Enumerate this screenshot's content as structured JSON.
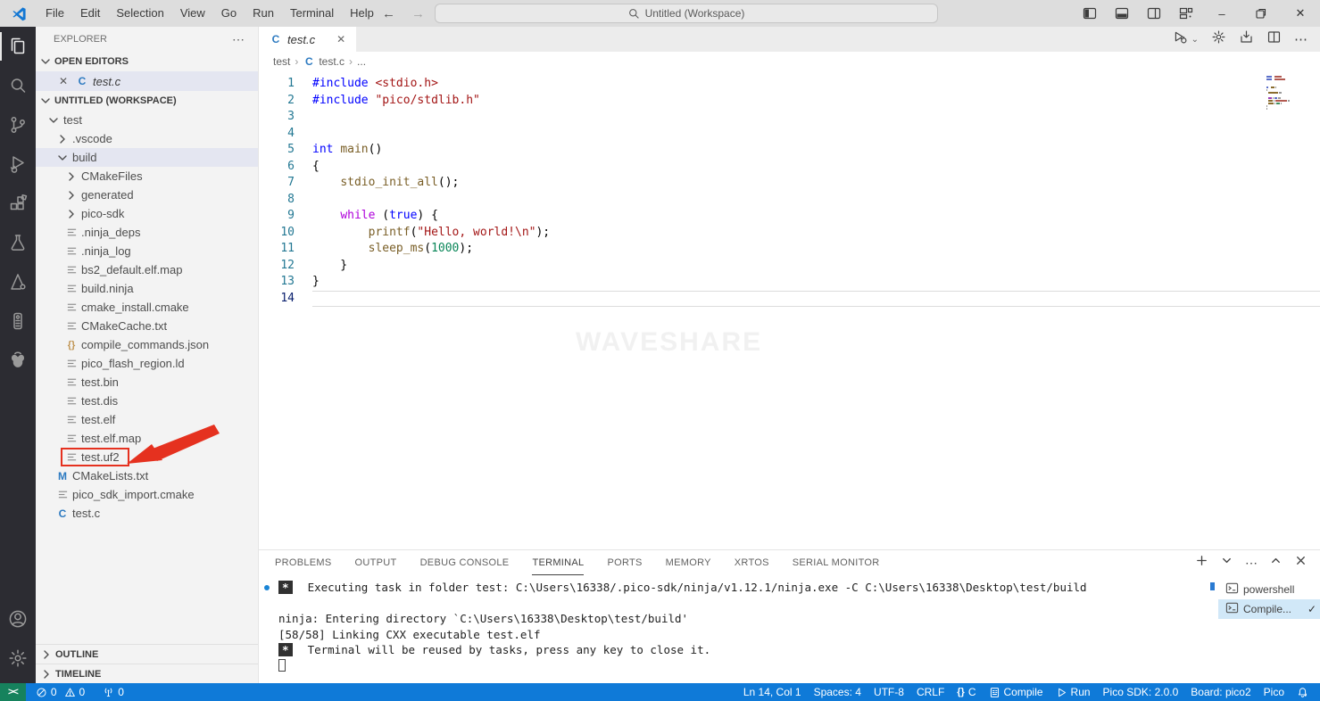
{
  "titlebar": {
    "menus": [
      "File",
      "Edit",
      "Selection",
      "View",
      "Go",
      "Run",
      "Terminal",
      "Help"
    ],
    "search_placeholder": "Untitled (Workspace)"
  },
  "activity_bar": {
    "top": [
      {
        "name": "explorer",
        "active": true
      },
      {
        "name": "search"
      },
      {
        "name": "source-control"
      },
      {
        "name": "run-and-debug"
      },
      {
        "name": "extensions"
      },
      {
        "name": "testing"
      },
      {
        "name": "cmake"
      },
      {
        "name": "pico-board"
      },
      {
        "name": "raspberry-pi"
      }
    ],
    "bottom": [
      {
        "name": "accounts"
      },
      {
        "name": "settings"
      }
    ]
  },
  "sidebar": {
    "title": "EXPLORER",
    "open_editors": {
      "label": "OPEN EDITORS",
      "items": [
        {
          "label": "test.c",
          "language": "c"
        }
      ]
    },
    "workspace_label": "UNTITLED (WORKSPACE)",
    "tree": [
      {
        "label": "test",
        "depth": 0,
        "kind": "folder",
        "expanded": true
      },
      {
        "label": ".vscode",
        "depth": 1,
        "kind": "folder",
        "expanded": false
      },
      {
        "label": "build",
        "depth": 1,
        "kind": "folder",
        "expanded": true,
        "selected": true
      },
      {
        "label": "CMakeFiles",
        "depth": 2,
        "kind": "folder",
        "expanded": false
      },
      {
        "label": "generated",
        "depth": 2,
        "kind": "folder",
        "expanded": false
      },
      {
        "label": "pico-sdk",
        "depth": 2,
        "kind": "folder",
        "expanded": false
      },
      {
        "label": ".ninja_deps",
        "depth": 2,
        "kind": "file",
        "icon": "lines"
      },
      {
        "label": ".ninja_log",
        "depth": 2,
        "kind": "file",
        "icon": "lines"
      },
      {
        "label": "bs2_default.elf.map",
        "depth": 2,
        "kind": "file",
        "icon": "lines"
      },
      {
        "label": "build.ninja",
        "depth": 2,
        "kind": "file",
        "icon": "lines"
      },
      {
        "label": "cmake_install.cmake",
        "depth": 2,
        "kind": "file",
        "icon": "lines"
      },
      {
        "label": "CMakeCache.txt",
        "depth": 2,
        "kind": "file",
        "icon": "lines"
      },
      {
        "label": "compile_commands.json",
        "depth": 2,
        "kind": "file",
        "icon": "json"
      },
      {
        "label": "pico_flash_region.ld",
        "depth": 2,
        "kind": "file",
        "icon": "lines"
      },
      {
        "label": "test.bin",
        "depth": 2,
        "kind": "file",
        "icon": "lines"
      },
      {
        "label": "test.dis",
        "depth": 2,
        "kind": "file",
        "icon": "lines"
      },
      {
        "label": "test.elf",
        "depth": 2,
        "kind": "file",
        "icon": "lines"
      },
      {
        "label": "test.elf.map",
        "depth": 2,
        "kind": "file",
        "icon": "lines"
      },
      {
        "label": "test.uf2",
        "depth": 2,
        "kind": "file",
        "icon": "lines",
        "annotated": true
      },
      {
        "label": "CMakeLists.txt",
        "depth": 1,
        "kind": "file",
        "icon": "M"
      },
      {
        "label": "pico_sdk_import.cmake",
        "depth": 1,
        "kind": "file",
        "icon": "lines"
      },
      {
        "label": "test.c",
        "depth": 1,
        "kind": "file",
        "icon": "C"
      }
    ],
    "outline_label": "OUTLINE",
    "timeline_label": "TIMELINE"
  },
  "editor": {
    "tab": {
      "label": "test.c",
      "language": "c"
    },
    "breadcrumb": [
      {
        "label": "test"
      },
      {
        "label": "test.c",
        "icon": "c"
      },
      {
        "label": "..."
      }
    ],
    "active_line": 14,
    "lines": [
      {
        "n": 1,
        "t": [
          [
            "#include",
            "kw"
          ],
          [
            " ",
            "pl"
          ],
          [
            "<stdio.h>",
            "str"
          ]
        ]
      },
      {
        "n": 2,
        "t": [
          [
            "#include",
            "kw"
          ],
          [
            " ",
            "pl"
          ],
          [
            "\"pico/stdlib.h\"",
            "str"
          ]
        ]
      },
      {
        "n": 3,
        "t": []
      },
      {
        "n": 4,
        "t": []
      },
      {
        "n": 5,
        "t": [
          [
            "int",
            "kw"
          ],
          [
            " ",
            "pl"
          ],
          [
            "main",
            "fn"
          ],
          [
            "()",
            "pl"
          ]
        ]
      },
      {
        "n": 6,
        "t": [
          [
            "{",
            "pl"
          ]
        ]
      },
      {
        "n": 7,
        "t": [
          [
            "    ",
            "pl"
          ],
          [
            "stdio_init_all",
            "fn"
          ],
          [
            "();",
            "pl"
          ]
        ]
      },
      {
        "n": 8,
        "t": []
      },
      {
        "n": 9,
        "t": [
          [
            "    ",
            "pl"
          ],
          [
            "while",
            "ctl"
          ],
          [
            " (",
            "pl"
          ],
          [
            "true",
            "kw"
          ],
          [
            ") {",
            "pl"
          ]
        ]
      },
      {
        "n": 10,
        "t": [
          [
            "        ",
            "pl"
          ],
          [
            "printf",
            "fn"
          ],
          [
            "(",
            "pl"
          ],
          [
            "\"Hello, world!\\n\"",
            "str"
          ],
          [
            ");",
            "pl"
          ]
        ]
      },
      {
        "n": 11,
        "t": [
          [
            "        ",
            "pl"
          ],
          [
            "sleep_ms",
            "fn"
          ],
          [
            "(",
            "pl"
          ],
          [
            "1000",
            "num"
          ],
          [
            ");",
            "pl"
          ]
        ]
      },
      {
        "n": 12,
        "t": [
          [
            "    }",
            "pl"
          ]
        ]
      },
      {
        "n": 13,
        "t": [
          [
            "}",
            "pl"
          ]
        ]
      },
      {
        "n": 14,
        "t": []
      }
    ],
    "watermark": "WAVESHARE"
  },
  "panel": {
    "tabs": [
      {
        "label": "PROBLEMS"
      },
      {
        "label": "OUTPUT"
      },
      {
        "label": "DEBUG CONSOLE"
      },
      {
        "label": "TERMINAL",
        "active": true
      },
      {
        "label": "PORTS"
      },
      {
        "label": "MEMORY"
      },
      {
        "label": "XRTOS"
      },
      {
        "label": "SERIAL MONITOR"
      }
    ],
    "terminal_lines": [
      {
        "dot": true,
        "badge": "*",
        "text": "  Executing task in folder test: C:\\Users\\16338/.pico-sdk/ninja/v1.12.1/ninja.exe -C C:\\Users\\16338\\Desktop\\test/build "
      },
      {
        "text": ""
      },
      {
        "text": "ninja: Entering directory `C:\\Users\\16338\\Desktop\\test/build'"
      },
      {
        "text": "[58/58] Linking CXX executable test.elf"
      },
      {
        "badge": "*",
        "text": "  Terminal will be reused by tasks, press any key to close it."
      },
      {
        "cursor": true,
        "text": ""
      }
    ],
    "terminal_list": [
      {
        "label": "powershell",
        "selected": false,
        "check": false
      },
      {
        "label": "Compile...",
        "selected": true,
        "check": true
      }
    ],
    "check_glyph": "✓"
  },
  "status_bar": {
    "errors": "0",
    "warnings": "0",
    "ports_count": "0",
    "right": [
      {
        "id": "cursor-position",
        "label": "Ln 14, Col 1"
      },
      {
        "id": "indentation",
        "label": "Spaces: 4"
      },
      {
        "id": "encoding",
        "label": "UTF-8"
      },
      {
        "id": "eol",
        "label": "CRLF"
      },
      {
        "id": "language-mode",
        "label": "C",
        "icon": "braces"
      },
      {
        "id": "compile",
        "label": "Compile",
        "icon": "file"
      },
      {
        "id": "run",
        "label": "Run",
        "icon": "play"
      },
      {
        "id": "pico-sdk",
        "label": "Pico SDK: 2.0.0"
      },
      {
        "id": "board",
        "label": "Board: pico2"
      },
      {
        "id": "pico",
        "label": "Pico"
      }
    ]
  },
  "colors": {
    "statusbar_blue": "#0f7ad8",
    "remote_green": "#16825d",
    "selection_row": "#e4e6f1",
    "annotation_red": "#e5311f",
    "accent_blue": "#1a85d6"
  }
}
